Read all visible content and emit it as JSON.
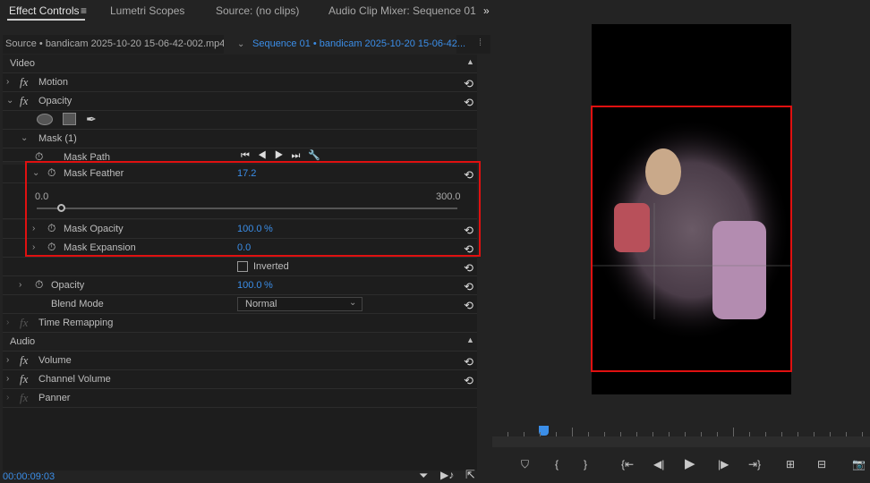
{
  "tabs": {
    "effect_controls": "Effect Controls",
    "menu_icon": "≡",
    "lumetri": "Lumetri Scopes",
    "source": "Source: (no clips)",
    "audio_mixer": "Audio Clip Mixer: Sequence 01",
    "overflow": "»"
  },
  "source_bar": {
    "source": "Source • bandicam 2025-10-20 15-06-42-002.mp4",
    "sequence": "Sequence 01 • bandicam 2025-10-20 15-06-42..."
  },
  "sections": {
    "video": "Video",
    "audio": "Audio"
  },
  "effects": {
    "motion": "Motion",
    "opacity": "Opacity",
    "mask": "Mask (1)",
    "mask_path": "Mask Path",
    "mask_feather": "Mask Feather",
    "mask_feather_value": "17.2",
    "slider_min": "0.0",
    "slider_max": "300.0",
    "mask_feather_fraction": 0.057,
    "mask_opacity": "Mask Opacity",
    "mask_opacity_value": "100.0",
    "mask_opacity_unit": "%",
    "mask_expansion": "Mask Expansion",
    "mask_expansion_value": "0.0",
    "inverted": "Inverted",
    "opacity2": "Opacity",
    "opacity2_value": "100.0",
    "opacity2_unit": "%",
    "blend_mode": "Blend Mode",
    "blend_mode_value": "Normal",
    "time_remapping": "Time Remapping",
    "volume": "Volume",
    "channel_volume": "Channel Volume",
    "panner": "Panner",
    "fx": "fx"
  },
  "footer": {
    "timecode": "00:00:09:03"
  },
  "accent": "#3b8ee8"
}
